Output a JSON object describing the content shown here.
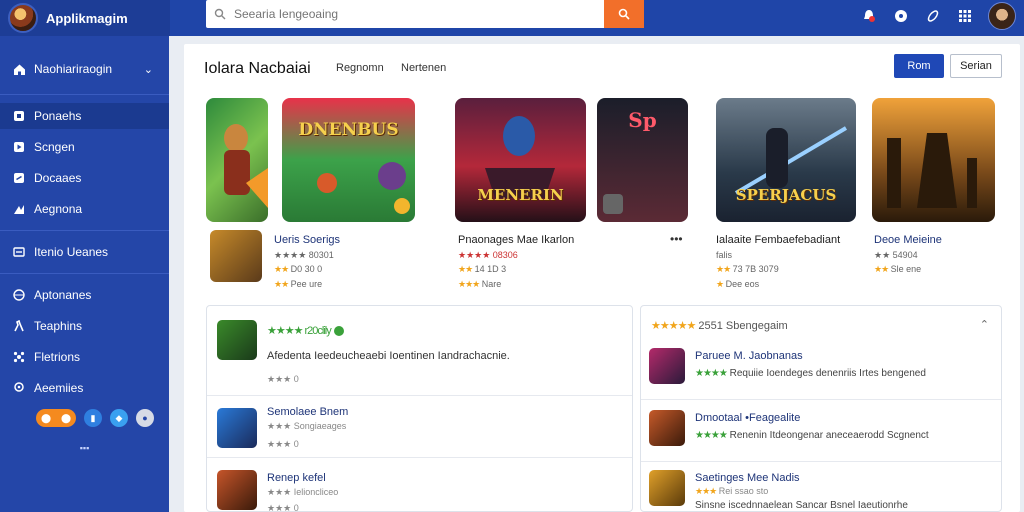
{
  "app": {
    "name": "Applikmagim"
  },
  "search": {
    "placeholder": "Seearia Iengeoaing"
  },
  "sidebar": {
    "header": "Naohiariraogin",
    "items": [
      {
        "label": "Ponaehs",
        "icon": "download-icon",
        "active": true
      },
      {
        "label": "Scngen",
        "icon": "play-icon",
        "active": false
      },
      {
        "label": "Docaaes",
        "icon": "link-icon",
        "active": false
      },
      {
        "label": "Aegnona",
        "icon": "chart-icon",
        "active": false
      }
    ],
    "section": "Itenio Ueanes",
    "items2": [
      {
        "label": "Aptonanes",
        "icon": "globe-icon"
      },
      {
        "label": "Teaphins",
        "icon": "person-icon"
      },
      {
        "label": "Fletrions",
        "icon": "puzzle-icon"
      },
      {
        "label": "Aeemiies",
        "icon": "pin-icon"
      }
    ],
    "footer": "▪▪▪"
  },
  "main": {
    "title": "Iolara Nacbaiai",
    "tabs": [
      "Regnomn",
      "Nertenen"
    ],
    "primary_button": "Rom",
    "secondary_button": "Serian"
  },
  "featured": [
    {
      "cover_text": "",
      "title": "Ueris Soerigs",
      "line1": "★★★★  80301",
      "line2_prefix": "★★",
      "line2": "D0 30 0",
      "line3_prefix": "★★",
      "line3": "Pee ure"
    },
    {
      "cover_text": "DNENBUS",
      "title": "",
      "line1": "",
      "line2_prefix": "",
      "line2": "",
      "line3_prefix": "",
      "line3": ""
    },
    {
      "cover_text": "MENERIN",
      "title": "Pnaonages Mae Ikarlon",
      "line1": "★★★★  08306",
      "line2_prefix": "★★",
      "line2": "14 1D 3",
      "line3_prefix": "★★★",
      "line3": "Nare"
    },
    {
      "cover_text": "Sp",
      "title": "",
      "line1": "",
      "line2_prefix": "",
      "line2": "",
      "line3_prefix": "",
      "line3": ""
    },
    {
      "cover_text": "SPERJACUS",
      "title": "Ialaaite Fembaefebadiant",
      "subtitle": "falis",
      "line2_prefix": "★★",
      "line2": "73 7B 3079",
      "line3_prefix": "★",
      "line3": "Dee eos"
    },
    {
      "cover_text": "",
      "title": "Deoe Meieine",
      "line1": "★★  54904",
      "line2_prefix": "★★",
      "line2": "Sle ene",
      "line3_prefix": "",
      "line3": ""
    }
  ],
  "more_label": "•••",
  "left_list": [
    {
      "header": "★★★★  r20clily",
      "title": "",
      "desc": "Afedenta Ieedeucheaebi Ioentinen Iandrachacnie.",
      "meta": "★★★  0"
    },
    {
      "header": "",
      "title": "Semolaee Bnem",
      "desc": "★★★  Songiaeages",
      "meta": "★★★  0"
    },
    {
      "header": "",
      "title": "Renep kefel",
      "desc": "★★★  Ielioncliceo",
      "meta": "★★★  0"
    }
  ],
  "right_panel": {
    "header_stars": "★★★★★",
    "header": "2551 Sbengegaim",
    "items": [
      {
        "title": "Paruee M. Jaobnanas",
        "stars": "★★★★",
        "desc": "Requiie Ioendeges denenriis Irtes bengened"
      },
      {
        "title": "Dmootaal  •Feagealite",
        "stars": "★★★★",
        "desc": "Renenin Itdeongenar aneceaerodd Scgnenct"
      },
      {
        "title": "Saetinges Mee Nadis",
        "stars": "★★★",
        "sub": "Rei ssao sto",
        "desc": "Sinsne iscednnaelean Sancar Bsnel Iaeutionrhe"
      }
    ]
  }
}
